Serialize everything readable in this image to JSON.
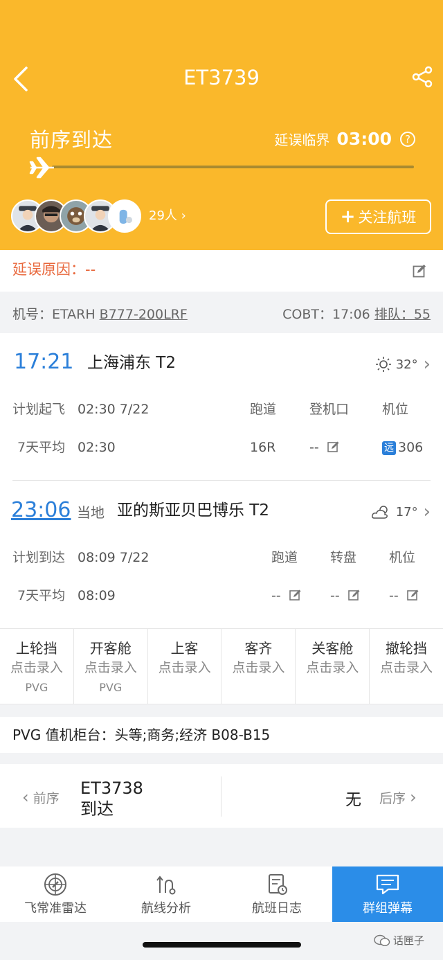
{
  "header": {
    "flight_no": "ET3739",
    "status": "前序到达",
    "critical_label": "延误临界",
    "critical_time": "03:00",
    "followers": "29人",
    "follow_button": "关注航班"
  },
  "delay": {
    "reason": "延误原因：--"
  },
  "aircraft": {
    "label": "机号：ETARH",
    "type": "B777-200LRF",
    "cobt": "COBT：17:06",
    "queue": "排队：55"
  },
  "departure": {
    "time": "17:21",
    "airport": "上海浦东 T2",
    "temp": "32°",
    "plan_label": "计划起飞",
    "plan_value": "02:30 7/22",
    "avg_label": "7天平均",
    "avg_value": "02:30",
    "col1": "跑道",
    "col2": "登机口",
    "col3": "机位",
    "runway": "16R",
    "gate": "--",
    "stand_tag": "远",
    "stand": "306"
  },
  "arrival": {
    "time": "23:06",
    "local": "当地",
    "airport": "亚的斯亚贝巴博乐 T2",
    "temp": "17°",
    "plan_label": "计划到达",
    "plan_value": "08:09 7/22",
    "avg_label": "7天平均",
    "avg_value": "08:09",
    "col1": "跑道",
    "col2": "转盘",
    "col3": "机位",
    "runway": "--",
    "carousel": "--",
    "stand": "--"
  },
  "ground_ops": [
    {
      "title": "上轮挡",
      "action": "点击录入",
      "place": "PVG"
    },
    {
      "title": "开客舱",
      "action": "点击录入",
      "place": "PVG"
    },
    {
      "title": "上客",
      "action": "点击录入",
      "place": ""
    },
    {
      "title": "客齐",
      "action": "点击录入",
      "place": ""
    },
    {
      "title": "关客舱",
      "action": "点击录入",
      "place": ""
    },
    {
      "title": "撤轮挡",
      "action": "点击录入",
      "place": ""
    }
  ],
  "counter": {
    "text": "PVG 值机柜台：头等;商务;经济 B08-B15"
  },
  "sequence": {
    "prev_label": "前序",
    "prev_flight": "ET3738",
    "prev_status": "到达",
    "next_value": "无",
    "next_label": "后序"
  },
  "tabs": [
    {
      "label": "飞常准雷达"
    },
    {
      "label": "航线分析"
    },
    {
      "label": "航班日志"
    },
    {
      "label": "群组弹幕"
    }
  ],
  "watermark": "话匣子",
  "colors": {
    "header": "#fab82b",
    "accent": "#2b7fd9",
    "delay": "#e8673b",
    "active_tab": "#2b8de8"
  }
}
